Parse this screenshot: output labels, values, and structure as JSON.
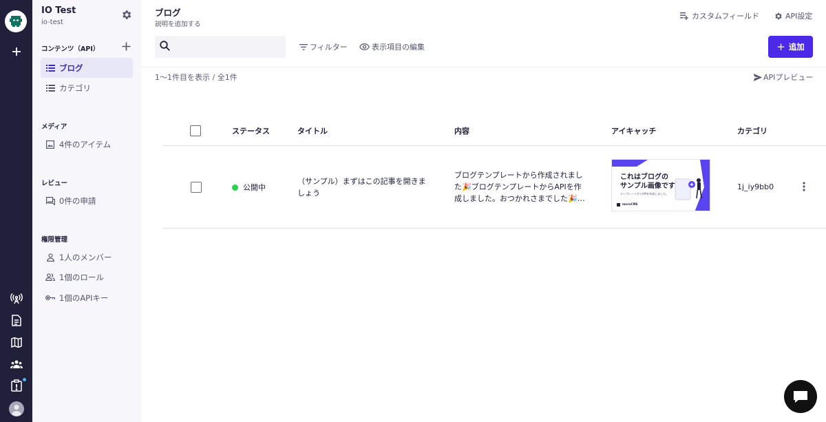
{
  "service": {
    "name": "IO Test",
    "id": "io-test"
  },
  "sidebar": {
    "contents_heading": "コンテンツ（API）",
    "contents_items": [
      {
        "label": "ブログ",
        "active": true
      },
      {
        "label": "カテゴリ",
        "active": false
      }
    ],
    "media_heading": "メディア",
    "media_item": "4件のアイテム",
    "review_heading": "レビュー",
    "review_item": "0件の申請",
    "perm_heading": "権限管理",
    "perm_items": [
      "1人のメンバー",
      "1個のロール",
      "1個のAPIキー"
    ]
  },
  "header": {
    "title": "ブログ",
    "description": "説明を追加する",
    "custom_fields": "カスタムフィールド",
    "api_settings": "API設定"
  },
  "toolbar": {
    "search_placeholder": "",
    "filter": "フィルター",
    "display_items": "表示項目の編集",
    "add": "追加"
  },
  "list": {
    "count_text": "1〜1件目を表示 / 全1件",
    "api_preview": "APIプレビュー",
    "columns": [
      "ステータス",
      "タイトル",
      "内容",
      "アイキャッチ",
      "カテゴリ"
    ],
    "rows": [
      {
        "status": "公開中",
        "title_line1": "（サンプル）まずはこの記事を開きま",
        "title_line2": "しょう",
        "content_line1": "ブログテンプレートから作成されまし",
        "content_line2": "た🎉ブログテンプレートからAPIを作",
        "content_line3": "成しました。おつかれさまでした🎉…",
        "eyecatch_line1": "これはブログの",
        "eyecatch_line2": "サンプル画像です",
        "eyecatch_sub": "テンプレートからAPIを作成しました。",
        "eyecatch_brand": "microCMS",
        "category": "1j_iy9bb0"
      }
    ]
  },
  "colors": {
    "accent": "#4a29e8",
    "status_published": "#2bd14a",
    "rail": "#20203a"
  }
}
